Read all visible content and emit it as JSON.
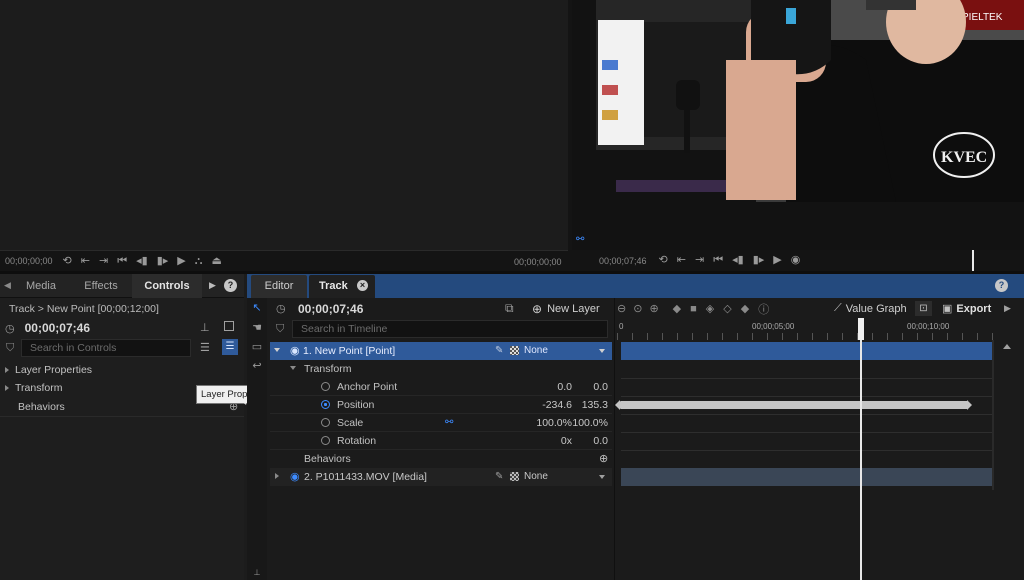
{
  "left_viewer": {
    "timecode_start": "00;00;00;00",
    "timecode_end": "00;00;00;00"
  },
  "right_viewer": {
    "timecode": "00;00;07;46",
    "video_text": {
      "brand_sign": "PIELTEK",
      "shirt_logo": "KVEC"
    }
  },
  "left_tabs": {
    "media": "Media",
    "effects": "Effects",
    "controls": "Controls"
  },
  "controls": {
    "breadcrumb": "Track > New Point [00;00;12;00]",
    "timecode": "00;00;07;46",
    "search_placeholder": "Search in Controls",
    "items": [
      {
        "label": "Layer Properties"
      },
      {
        "label": "Transform"
      },
      {
        "label": "Behaviors"
      }
    ],
    "tooltip": "Layer Properties"
  },
  "editor_tabs": {
    "editor": "Editor",
    "track": "Track"
  },
  "timeline": {
    "timecode": "00;00;07;46",
    "new_layer": "New Layer",
    "value_graph": "Value Graph",
    "export": "Export",
    "search_placeholder": "Search in Timeline",
    "ruler": [
      "0",
      "00;00;05;00",
      "00;00;10;00"
    ],
    "playhead_seconds": 7.46,
    "layers": [
      {
        "name": "1. New Point [Point]",
        "blend": "None"
      },
      {
        "name": "2. P1011433.MOV [Media]",
        "blend": "None"
      }
    ],
    "transform_label": "Transform",
    "behaviors_label": "Behaviors",
    "properties": [
      {
        "name": "Anchor Point",
        "v1": "0.0",
        "v2": "0.0",
        "active": false
      },
      {
        "name": "Position",
        "v1": "-234.6",
        "v2": "135.3",
        "active": true
      },
      {
        "name": "Scale",
        "v1": "100.0%",
        "v2": "100.0%",
        "active": false
      },
      {
        "name": "Rotation",
        "v1": "0x",
        "v2": "0.0",
        "active": false
      }
    ]
  },
  "colors": {
    "accent_blue": "#244a7e",
    "selected_layer": "#2f5a9a",
    "track_bar": "#c4c4c4"
  }
}
